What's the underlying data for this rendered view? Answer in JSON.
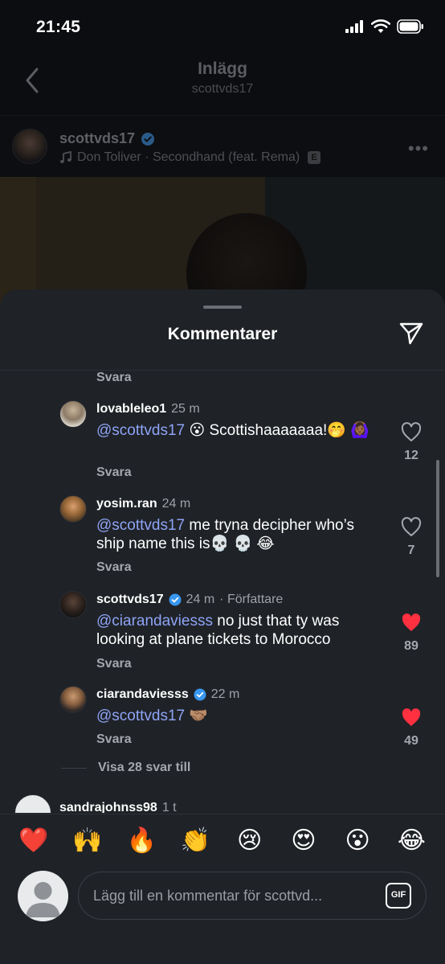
{
  "status_bar": {
    "time": "21:45"
  },
  "nav": {
    "title": "Inlägg",
    "subtitle": "scottvds17"
  },
  "post": {
    "username": "scottvds17",
    "music": "Don Toliver · Secondhand (feat. Rema)",
    "explicit_badge": "E"
  },
  "sheet": {
    "title": "Kommentarer",
    "reply_label_top": "Svara"
  },
  "comments": [
    {
      "username": "lovableleo1",
      "time": "25 m",
      "mention": "@scottvds17",
      "text": " 😮 Scottishaaaaaaa!🤭 🙆🏾‍♀️",
      "reply": "Svara",
      "likes": "12",
      "liked": false
    },
    {
      "username": "yosim.ran",
      "time": "24 m",
      "mention": "@scottvds17",
      "text": " me tryna decipher who’s ship name this is💀 💀 😂",
      "reply": "Svara",
      "likes": "7",
      "liked": false
    },
    {
      "username": "scottvds17",
      "time": "24 m",
      "author_tag": "· Författare",
      "mention": "@ciarandaviesss",
      "text": " no just that ty was looking at plane tickets to Morocco",
      "reply": "Svara",
      "likes": "89",
      "liked": true
    },
    {
      "username": "ciarandaviesss",
      "time": "22 m",
      "mention": "@scottvds17",
      "text": " 🤝🏽",
      "reply": "Svara",
      "likes": "49",
      "liked": true
    }
  ],
  "more_replies": "Visa 28 svar till",
  "next_comment": {
    "username": "sandrajohnss98",
    "time": "1 t"
  },
  "emoji_bar": [
    "❤️",
    "🙌",
    "🔥",
    "👏",
    "😢",
    "😍",
    "😮",
    "😂"
  ],
  "composer": {
    "placeholder": "Lägg till en kommentar för scottvd...",
    "gif_label": "GIF"
  },
  "colors": {
    "like_active": "#ff3040",
    "mention": "#8ea4f5",
    "verified": "#3897f0"
  }
}
